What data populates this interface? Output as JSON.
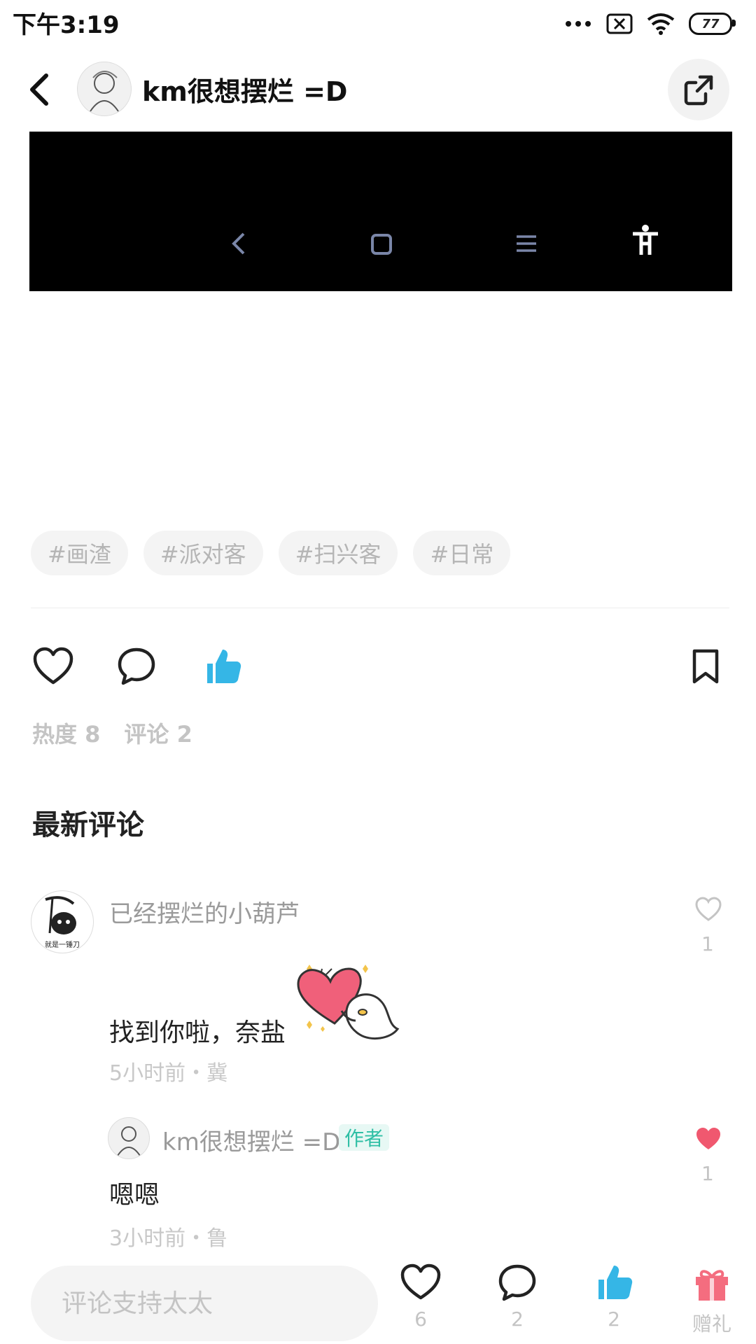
{
  "status_bar": {
    "time": "下午3:19",
    "battery": "77"
  },
  "header": {
    "username": "km很想摆烂 =D"
  },
  "tags": [
    "#画渣",
    "#派对客",
    "#扫兴客",
    "#日常"
  ],
  "stats": {
    "heat": "热度 8",
    "comments": "评论 2"
  },
  "section_title": "最新评论",
  "comment": {
    "username": "已经摆烂的小葫芦",
    "avatar_caption": "就是一锤刀",
    "text": "找到你啦，奈盐",
    "meta": "5小时前・冀",
    "like_count": "1"
  },
  "reply": {
    "username": "km很想摆烂 =D",
    "badge": "作者",
    "text": "嗯嗯",
    "meta": "3小时前・鲁",
    "like_count": "1"
  },
  "bottom_bar": {
    "input_placeholder": "评论支持太太",
    "like_count": "6",
    "comment_count": "2",
    "thumb_count": "2",
    "gift_label": "赠礼"
  },
  "colors": {
    "accent_blue": "#35b6e6",
    "like_red": "#f0586f",
    "gift_pink": "#f46d7f",
    "badge_green": "#2fbfa5"
  },
  "icons": [
    "back-icon",
    "share-icon",
    "heart-icon",
    "comment-icon",
    "thumb-up-icon",
    "bookmark-icon",
    "gift-icon"
  ]
}
